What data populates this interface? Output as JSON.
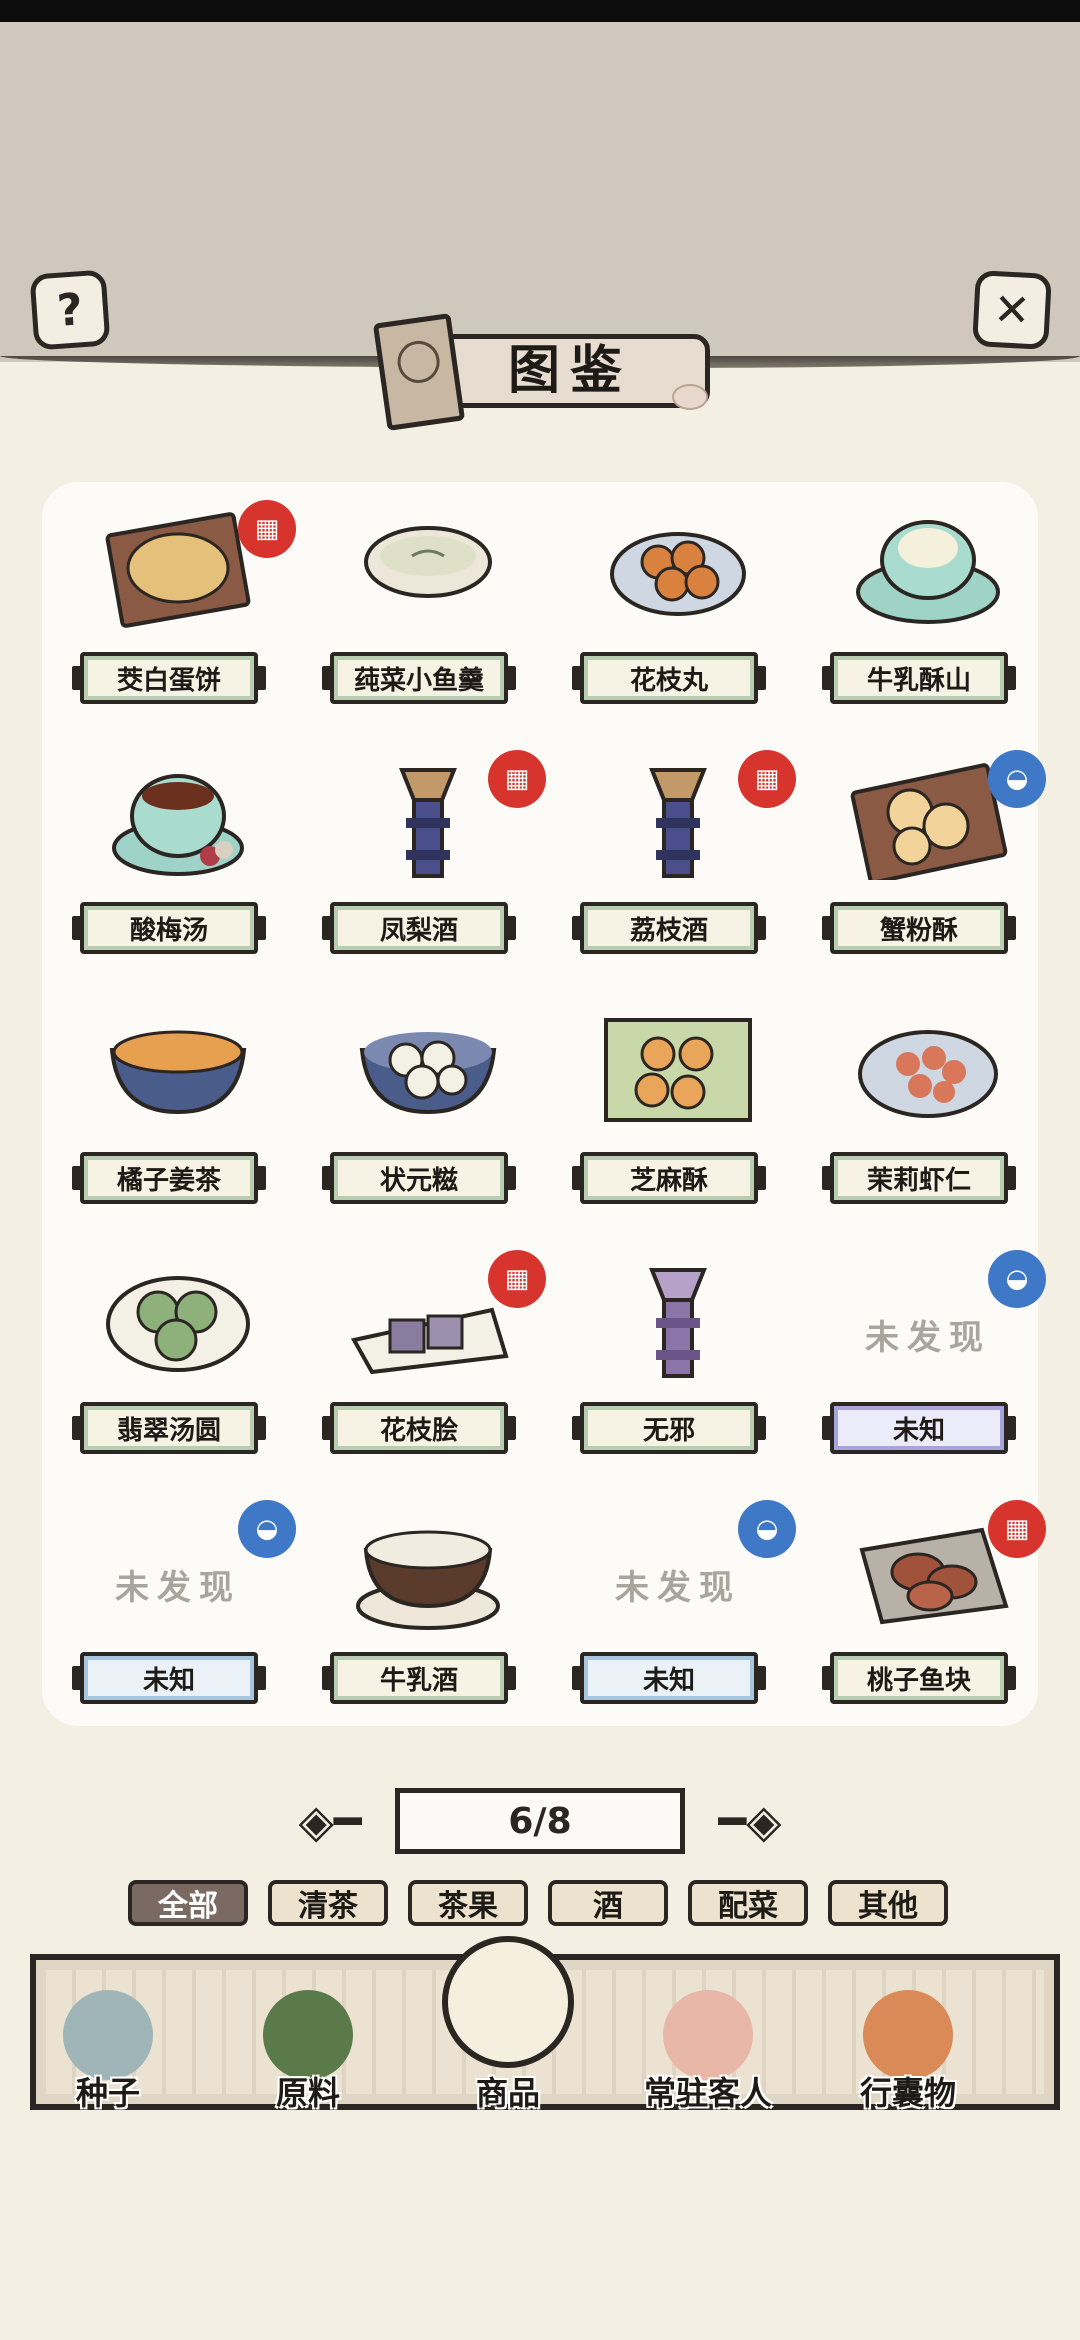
{
  "header": {
    "title": "图鉴",
    "help_icon": "question-icon",
    "close_icon": "close-icon"
  },
  "items": [
    {
      "name": "茭白蛋饼",
      "badge": "red",
      "food": "pancake"
    },
    {
      "name": "莼菜小鱼羹",
      "badge": "",
      "food": "soup"
    },
    {
      "name": "花枝丸",
      "badge": "",
      "food": "balls"
    },
    {
      "name": "牛乳酥山",
      "badge": "",
      "food": "teacup"
    },
    {
      "name": "酸梅汤",
      "badge": "",
      "food": "tea"
    },
    {
      "name": "凤梨酒",
      "badge": "red",
      "food": "wine"
    },
    {
      "name": "荔枝酒",
      "badge": "red",
      "food": "wine"
    },
    {
      "name": "蟹粉酥",
      "badge": "blue",
      "food": "tray"
    },
    {
      "name": "橘子姜茶",
      "badge": "",
      "food": "orangebowl"
    },
    {
      "name": "状元糍",
      "badge": "",
      "food": "dumplings"
    },
    {
      "name": "芝麻酥",
      "badge": "",
      "food": "sesame"
    },
    {
      "name": "茉莉虾仁",
      "badge": "",
      "food": "shrimp"
    },
    {
      "name": "翡翠汤圆",
      "badge": "",
      "food": "green"
    },
    {
      "name": "花枝脍",
      "badge": "red",
      "food": "sashimi"
    },
    {
      "name": "无邪",
      "badge": "",
      "food": "purplewine"
    },
    {
      "name": "未知",
      "badge": "blue",
      "food": "",
      "undiscovered": "未发现",
      "label_style": "unknown-purple"
    },
    {
      "name": "未知",
      "badge": "blue",
      "food": "",
      "undiscovered": "未发现",
      "label_style": "unknown-blue"
    },
    {
      "name": "牛乳酒",
      "badge": "",
      "food": "milkbowl"
    },
    {
      "name": "未知",
      "badge": "blue",
      "food": "",
      "undiscovered": "未发现",
      "label_style": "unknown-blue"
    },
    {
      "name": "桃子鱼块",
      "badge": "red",
      "food": "fish"
    }
  ],
  "pagination": {
    "text": "6/8"
  },
  "filters": [
    "全部",
    "清茶",
    "茶果",
    "酒",
    "配菜",
    "其他"
  ],
  "active_filter": "全部",
  "tabs": [
    {
      "label": "种子",
      "icon": "seed-jar-icon"
    },
    {
      "label": "原料",
      "icon": "leaf-icon"
    },
    {
      "label": "商品",
      "icon": "pastry-plate-icon",
      "active": true
    },
    {
      "label": "常驻客人",
      "icon": "guest-girl-icon"
    },
    {
      "label": "行囊物",
      "icon": "robe-icon"
    }
  ],
  "colors": {
    "badge_red": "#d8342e",
    "badge_blue": "#3f78c6",
    "paper": "#f3efe3",
    "top_band": "#d1c8bd"
  }
}
